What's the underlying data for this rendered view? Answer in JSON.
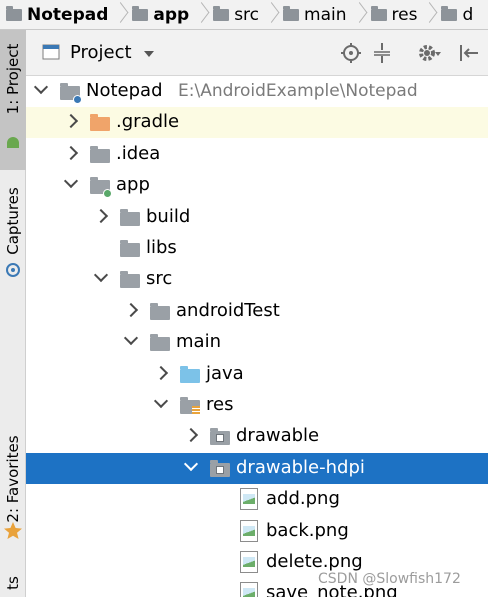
{
  "breadcrumb": [
    {
      "label": "Notepad",
      "icon": "folder-icon",
      "bold": true
    },
    {
      "label": "app",
      "icon": "module-folder-icon",
      "bold": true
    },
    {
      "label": "src",
      "icon": "folder-icon",
      "bold": false
    },
    {
      "label": "main",
      "icon": "folder-icon",
      "bold": false
    },
    {
      "label": "res",
      "icon": "resources-folder-icon",
      "bold": false
    },
    {
      "label": "d",
      "icon": "folder-icon",
      "bold": false
    }
  ],
  "left_strip": {
    "project_tab": "1: Project",
    "captures_tab": "Captures",
    "favorites_tab": "2: Favorites",
    "partial_tab": "ts"
  },
  "panel": {
    "title": "Project",
    "icons": [
      "locate-icon",
      "collapse-all-icon",
      "gear-icon",
      "hide-panel-icon"
    ]
  },
  "tree": [
    {
      "label": "Notepad",
      "path": "E:\\AndroidExample\\Notepad",
      "depth": 0,
      "expanded": true,
      "icon": "project-folder-icon"
    },
    {
      "label": ".gradle",
      "depth": 1,
      "expanded": false,
      "icon": "folder-icon-orange"
    },
    {
      "label": ".idea",
      "depth": 1,
      "expanded": false,
      "icon": "folder-icon"
    },
    {
      "label": "app",
      "depth": 1,
      "expanded": true,
      "icon": "module-folder-icon"
    },
    {
      "label": "build",
      "depth": 2,
      "expanded": false,
      "icon": "folder-icon"
    },
    {
      "label": "libs",
      "depth": 2,
      "icon": "folder-icon"
    },
    {
      "label": "src",
      "depth": 2,
      "expanded": true,
      "icon": "folder-icon"
    },
    {
      "label": "androidTest",
      "depth": 3,
      "expanded": false,
      "icon": "folder-icon"
    },
    {
      "label": "main",
      "depth": 3,
      "expanded": true,
      "icon": "folder-icon"
    },
    {
      "label": "java",
      "depth": 4,
      "expanded": false,
      "icon": "source-folder-icon"
    },
    {
      "label": "res",
      "depth": 4,
      "expanded": true,
      "icon": "resources-folder-icon"
    },
    {
      "label": "drawable",
      "depth": 5,
      "expanded": false,
      "icon": "drawable-folder-icon"
    },
    {
      "label": "drawable-hdpi",
      "depth": 5,
      "expanded": true,
      "icon": "drawable-folder-icon",
      "selected": true
    },
    {
      "label": "add.png",
      "depth": 6,
      "icon": "png-file-icon"
    },
    {
      "label": "back.png",
      "depth": 6,
      "icon": "png-file-icon"
    },
    {
      "label": "delete.png",
      "depth": 6,
      "icon": "png-file-icon"
    },
    {
      "label": "save_note.png",
      "depth": 6,
      "icon": "png-file-icon"
    }
  ],
  "watermark": "CSDN @Slowfish172",
  "colors": {
    "selection": "#1d72c4",
    "highlight_row": "#fcfbe3",
    "module_dot": "#59a869"
  }
}
